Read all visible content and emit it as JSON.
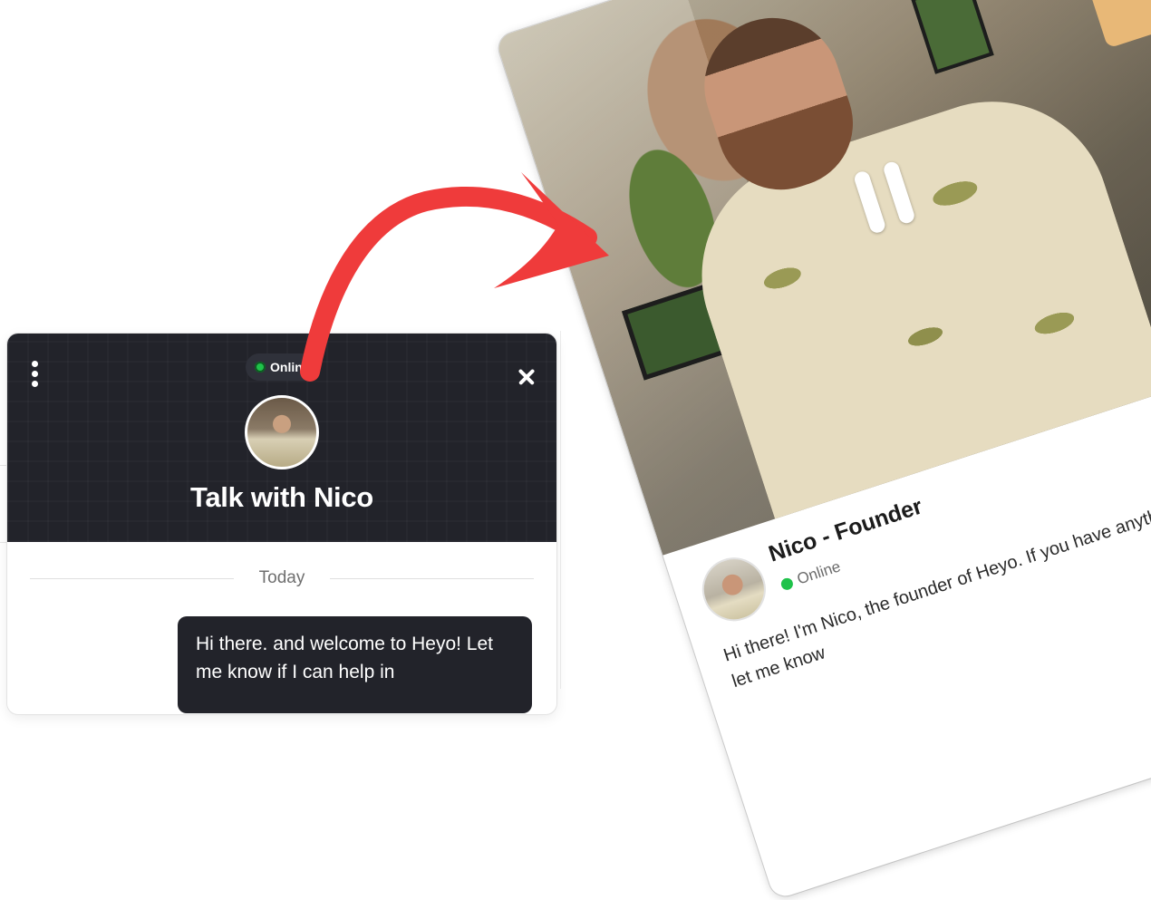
{
  "widget": {
    "status": "Online",
    "title": "Talk with Nico",
    "date_divider": "Today",
    "message": "Hi there. and welcome to Heyo! Let me know if I can help in"
  },
  "card": {
    "name": "Nico - Founder",
    "status": "Online",
    "message": "Hi there! I'm Nico, the founder of Heyo. If you have anything, please let me know"
  },
  "icons": {
    "menu": "more-vertical-icon",
    "close": "close-icon",
    "status_dot": "online-dot-icon",
    "pause": "pause-icon"
  },
  "colors": {
    "header_bg": "#22232a",
    "online_green": "#1fc24a",
    "arrow_red": "#ef3b3b"
  }
}
